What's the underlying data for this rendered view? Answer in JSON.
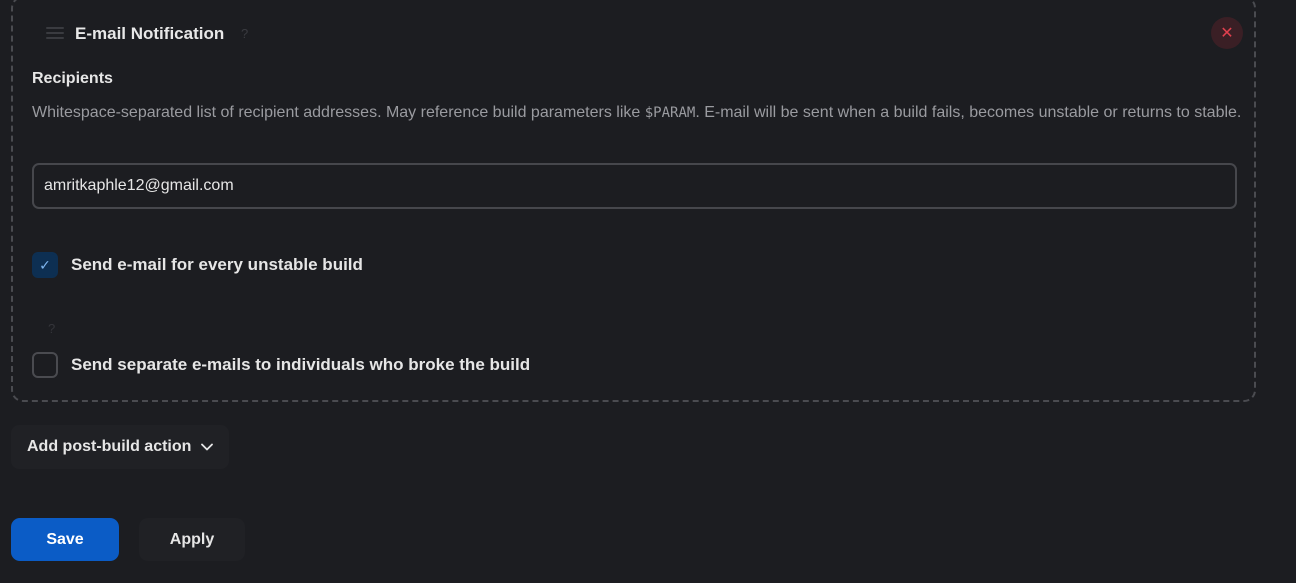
{
  "section": {
    "title": "E-mail Notification",
    "help_mark": "?",
    "close_symbol": "✕"
  },
  "recipients": {
    "label": "Recipients",
    "description_before": "Whitespace-separated list of recipient addresses. May reference build parameters like ",
    "description_code": "$PARAM",
    "description_after": ". E-mail will be sent when a build fails, becomes unstable or returns to stable.",
    "value": "amritkaphle12@gmail.com"
  },
  "options": [
    {
      "label": "Send e-mail for every unstable build",
      "checked": true
    },
    {
      "label": "Send separate e-mails to individuals who broke the build",
      "checked": false
    }
  ],
  "option_help_mark": "?",
  "actions": {
    "add_post_build": "Add post-build action",
    "chevron": "⌄",
    "save": "Save",
    "apply": "Apply"
  },
  "check_symbol": "✓",
  "colors": {
    "background": "#1c1d21",
    "primary": "#0b5cc6",
    "danger": "#e0404e"
  }
}
